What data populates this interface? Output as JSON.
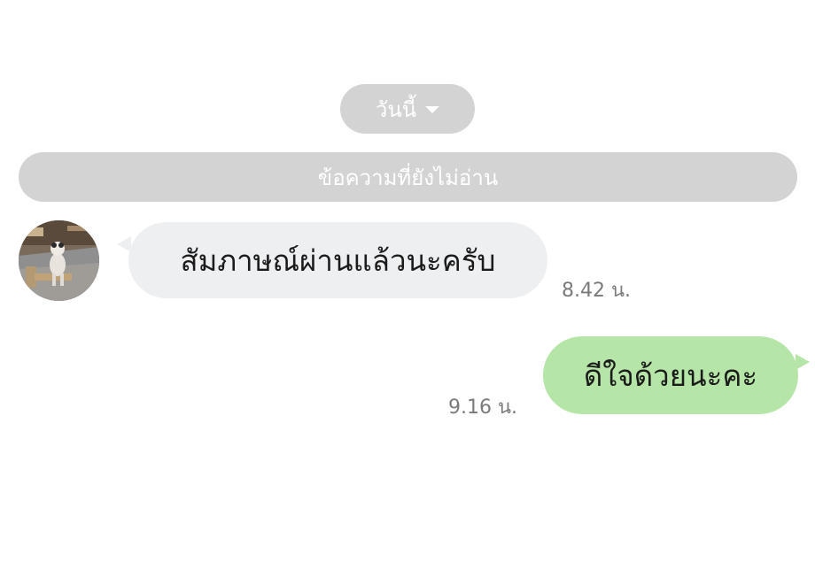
{
  "date_chip": {
    "label": "วันนี้",
    "icon": "caret-down-icon"
  },
  "unread_divider": {
    "label": "ข้อความที่ยังไม่อ่าน"
  },
  "messages": [
    {
      "direction": "incoming",
      "text": "สัมภาษณ์ผ่านแล้วนะครับ",
      "time": "8.42 น.",
      "avatar": "dog-photo"
    },
    {
      "direction": "outgoing",
      "text": "ดีใจด้วยนะคะ",
      "time": "9.16 น."
    }
  ],
  "colors": {
    "chip_bg": "#d3d3d3",
    "incoming_bubble": "#eeeff1",
    "outgoing_bubble": "#b6e6a7",
    "time_text": "#7a7a7a"
  }
}
